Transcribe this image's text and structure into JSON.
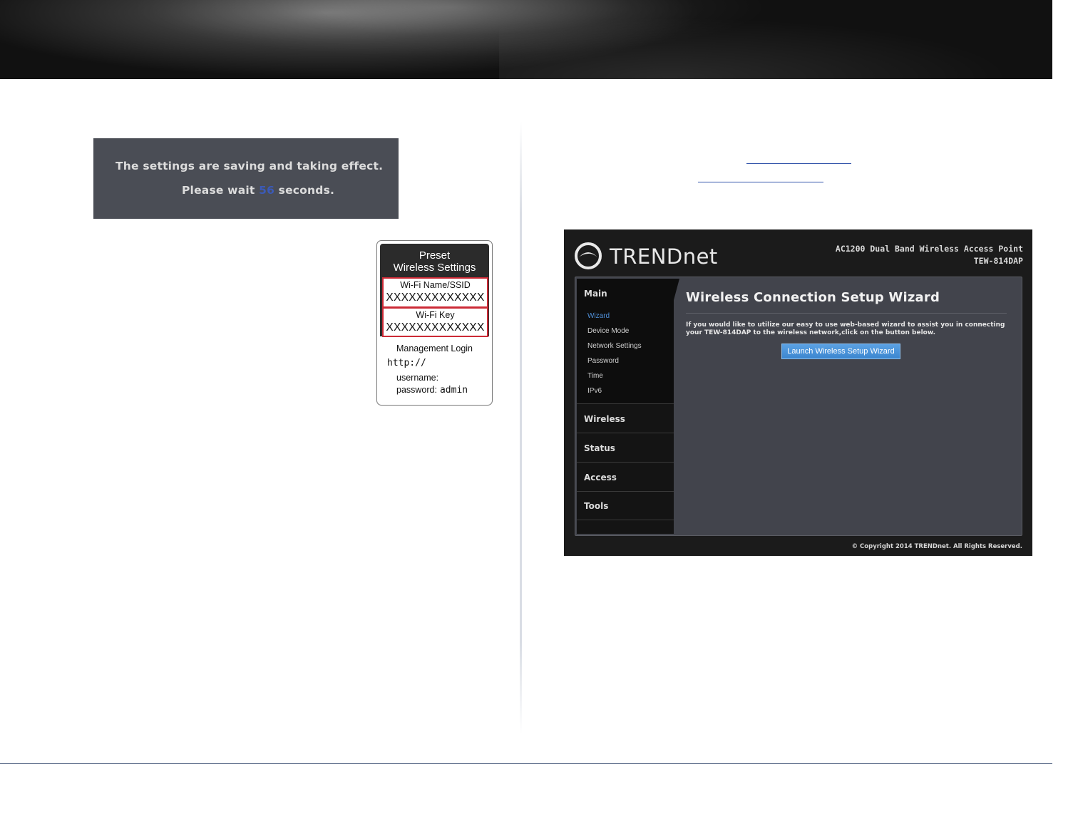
{
  "notice": {
    "line1": "The settings are saving and taking effect.",
    "wait_prefix": "Please wait ",
    "wait_count": "56",
    "wait_suffix": " seconds."
  },
  "sticker": {
    "title_line1": "Preset",
    "title_line2": "Wireless Settings",
    "ssid_label": "Wi-Fi Name/SSID",
    "ssid_value": "XXXXXXXXXXXXX",
    "key_label": "Wi-Fi Key",
    "key_value": "XXXXXXXXXXXXX",
    "mgmt_title": "Management Login",
    "url_prefix": "http://",
    "username_label": "username:",
    "password_label": "password:",
    "password_value": "admin"
  },
  "router_ui": {
    "brand": "TRENDnet",
    "product_name": "AC1200 Dual Band Wireless Access Point",
    "model": "TEW-814DAP",
    "sidebar": {
      "main": "Main",
      "main_items": [
        "Wizard",
        "Device Mode",
        "Network Settings",
        "Password",
        "Time",
        "IPv6"
      ],
      "active_item": "Wizard",
      "sections": [
        "Wireless",
        "Status",
        "Access",
        "Tools"
      ]
    },
    "page_title": "Wireless Connection Setup Wizard",
    "description": "If you would like to utilize our easy to use web-based wizard to assist you in connecting your TEW-814DAP to the wireless network,click on the button below.",
    "launch_button": "Launch Wireless Setup Wizard",
    "copyright": "© Copyright 2014 TRENDnet. All Rights Reserved."
  },
  "colors": {
    "notice_bg": "#4a4d55",
    "count_color": "#3b5ab8",
    "sticker_highlight": "#cc2a36",
    "button_blue": "#3c86cf"
  }
}
